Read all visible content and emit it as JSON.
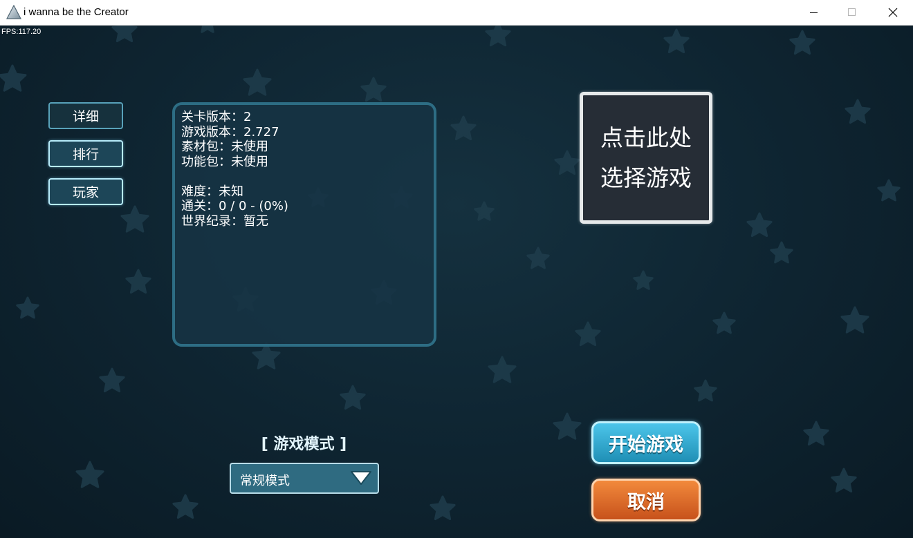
{
  "window": {
    "title": "i wanna be the Creator",
    "icon": "triangle-icon",
    "controls": [
      "minimize-icon",
      "maximize-icon",
      "close-icon"
    ]
  },
  "hud": {
    "fps": "FPS:117.20"
  },
  "sidebar": {
    "items": [
      {
        "label": "详细"
      },
      {
        "label": "排行"
      },
      {
        "label": "玩家"
      }
    ]
  },
  "info": {
    "lines": [
      "关卡版本：2",
      "游戏版本：2.727",
      "素材包：未使用",
      "功能包：未使用",
      "难度：未知",
      "通关：0 / 0 - (0%)",
      "世界纪录：暂无"
    ]
  },
  "select_game": {
    "line1": "点击此处",
    "line2": "选择游戏"
  },
  "mode": {
    "label": "[ 游戏模式 ]",
    "selected": "常规模式",
    "icon": "triangle-down-icon"
  },
  "actions": {
    "start": "开始游戏",
    "cancel": "取消"
  },
  "colors": {
    "background": "#0f2633",
    "panel_border": "#2d6d84",
    "start_button": "#2ba6cf",
    "cancel_button": "#e06f2c",
    "select_box": "#262d36"
  }
}
